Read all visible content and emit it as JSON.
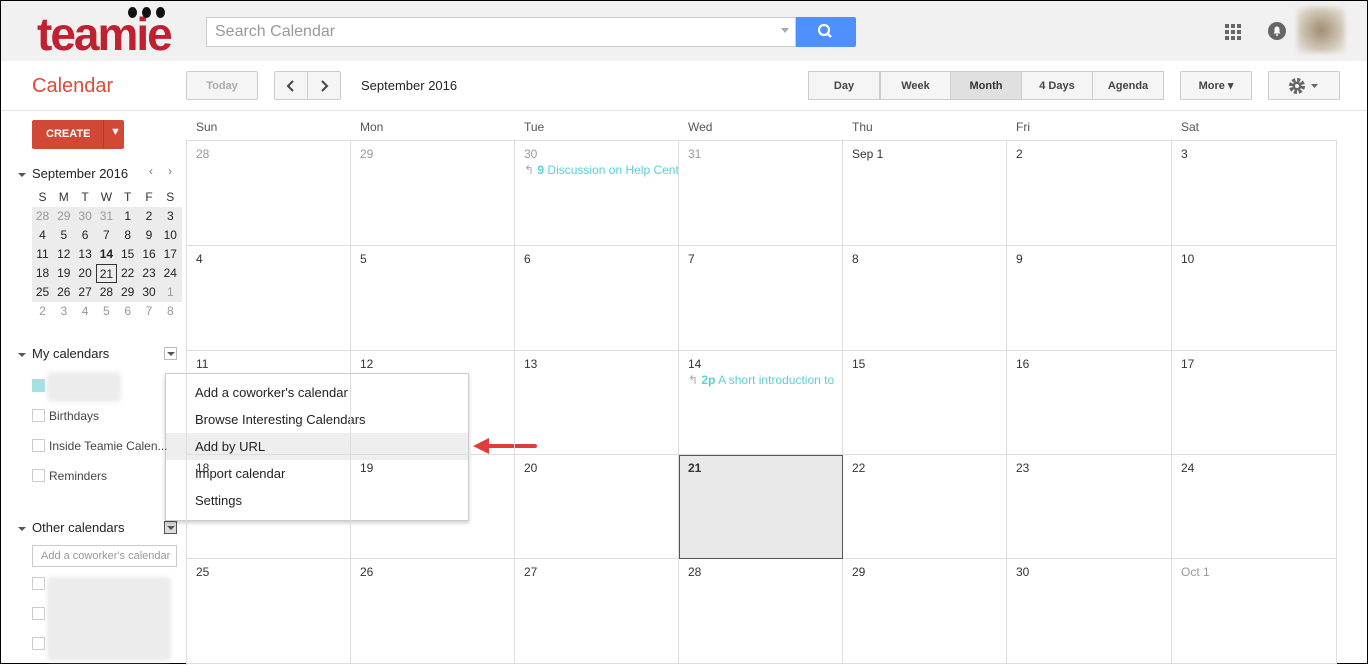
{
  "header": {
    "logo": "teamie",
    "search_placeholder": "Search Calendar"
  },
  "toolbar": {
    "title": "Calendar",
    "today": "Today",
    "month_label": "September 2016",
    "views": [
      "Day",
      "Week",
      "Month",
      "4 Days",
      "Agenda"
    ],
    "active_view": "Month",
    "more": "More ▾"
  },
  "sidebar": {
    "create": "CREATE",
    "mini_title": "September 2016",
    "mini_days": [
      "S",
      "M",
      "T",
      "W",
      "T",
      "F",
      "S"
    ],
    "mini_weeks": [
      [
        "28",
        "29",
        "30",
        "31",
        "1",
        "2",
        "3"
      ],
      [
        "4",
        "5",
        "6",
        "7",
        "8",
        "9",
        "10"
      ],
      [
        "11",
        "12",
        "13",
        "14",
        "15",
        "16",
        "17"
      ],
      [
        "18",
        "19",
        "20",
        "21",
        "22",
        "23",
        "24"
      ],
      [
        "25",
        "26",
        "27",
        "28",
        "29",
        "30",
        "1"
      ],
      [
        "2",
        "3",
        "4",
        "5",
        "6",
        "7",
        "8"
      ]
    ],
    "my_calendars": "My calendars",
    "my_items": [
      "Birthdays",
      "Inside Teamie Calen...",
      "Reminders"
    ],
    "other_calendars": "Other calendars",
    "coworker_placeholder": "Add a coworker's calendar"
  },
  "grid": {
    "days": [
      "Sun",
      "Mon",
      "Tue",
      "Wed",
      "Thu",
      "Fri",
      "Sat"
    ],
    "weeks": [
      [
        "28",
        "29",
        "30",
        "31",
        "Sep 1",
        "2",
        "3"
      ],
      [
        "4",
        "5",
        "6",
        "7",
        "8",
        "9",
        "10"
      ],
      [
        "11",
        "12",
        "13",
        "14",
        "15",
        "16",
        "17"
      ],
      [
        "18",
        "19",
        "20",
        "21",
        "22",
        "23",
        "24"
      ],
      [
        "25",
        "26",
        "27",
        "28",
        "29",
        "30",
        "Oct 1"
      ]
    ],
    "events": [
      {
        "week": 0,
        "day": 2,
        "time": "9",
        "title": "Discussion on Help Center"
      },
      {
        "week": 2,
        "day": 3,
        "time": "2p",
        "title": "A short introduction to"
      }
    ]
  },
  "menu": {
    "items": [
      "Add a coworker's calendar",
      "Browse Interesting Calendars",
      "Add by URL",
      "Import calendar",
      "Settings"
    ],
    "highlighted": "Add by URL"
  },
  "colors": {
    "accent": "#dd4b39",
    "event": "#5ccfd6",
    "search": "#4d90fe",
    "arrow": "#e03c3c"
  }
}
